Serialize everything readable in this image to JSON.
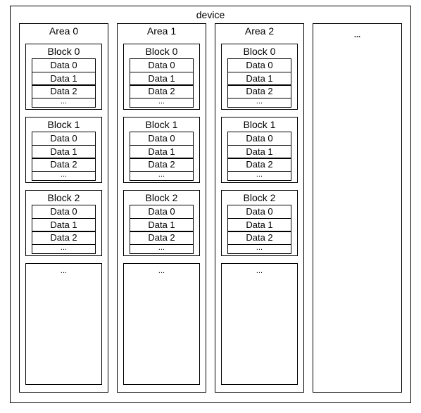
{
  "title": "device",
  "ellipsis": "...",
  "areas": [
    {
      "title": "Area 0",
      "blocks": [
        {
          "title": "Block 0",
          "data": [
            "Data 0",
            "Data 1",
            "Data 2"
          ]
        },
        {
          "title": "Block 1",
          "data": [
            "Data 0",
            "Data 1",
            "Data 2"
          ]
        },
        {
          "title": "Block 2",
          "data": [
            "Data 0",
            "Data 1",
            "Data 2"
          ]
        }
      ]
    },
    {
      "title": "Area 1",
      "blocks": [
        {
          "title": "Block 0",
          "data": [
            "Data 0",
            "Data 1",
            "Data 2"
          ]
        },
        {
          "title": "Block 1",
          "data": [
            "Data 0",
            "Data 1",
            "Data 2"
          ]
        },
        {
          "title": "Block 2",
          "data": [
            "Data 0",
            "Data 1",
            "Data 2"
          ]
        }
      ]
    },
    {
      "title": "Area 2",
      "blocks": [
        {
          "title": "Block 0",
          "data": [
            "Data 0",
            "Data 1",
            "Data 2"
          ]
        },
        {
          "title": "Block 1",
          "data": [
            "Data 0",
            "Data 1",
            "Data 2"
          ]
        },
        {
          "title": "Block 2",
          "data": [
            "Data 0",
            "Data 1",
            "Data 2"
          ]
        }
      ]
    }
  ]
}
